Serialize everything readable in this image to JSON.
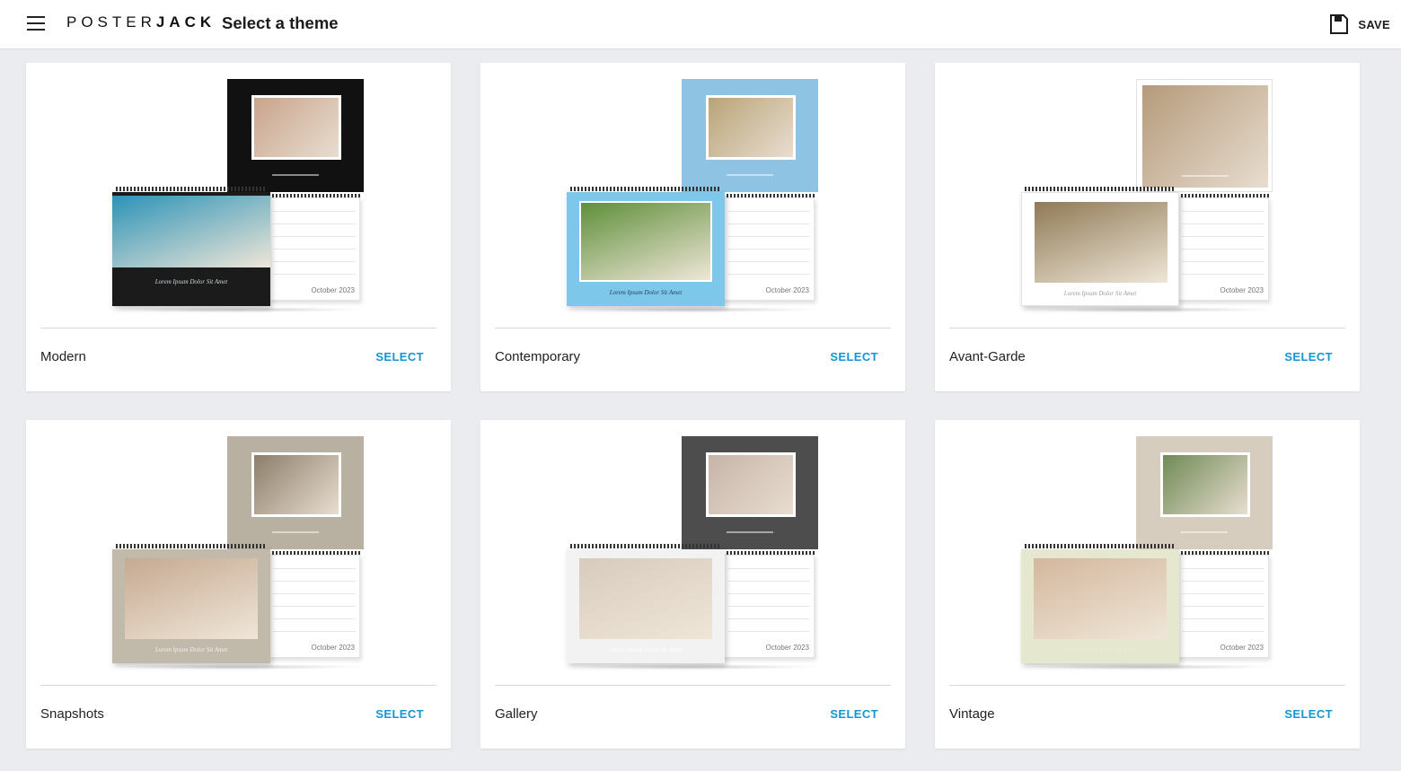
{
  "header": {
    "logo_regular": "POSTER",
    "logo_bold": "JACK",
    "title": "Select a theme",
    "save_label": "SAVE"
  },
  "calendar_month": "October 2023",
  "themes": [
    {
      "name": "Modern",
      "select_label": "SELECT",
      "back_color": "#111111",
      "front_color": "#1b1b1b",
      "photo_back": "#c9a48c",
      "photo_front": "#2c93b7",
      "caption": "Lorem Ipsum Dolor Sit Amet",
      "caption_color": "#cfd6db"
    },
    {
      "name": "Contemporary",
      "select_label": "SELECT",
      "back_color": "#8ec3e3",
      "front_color": "#7dc7ea",
      "photo_back": "#b9a478",
      "photo_front": "#5f8f3a",
      "caption": "Lorem Ipsum Dolor Sit Amet",
      "caption_color": "#24425a"
    },
    {
      "name": "Avant-Garde",
      "select_label": "SELECT",
      "back_color": "#ffffff",
      "front_color": "#ffffff",
      "photo_back": "#b59a7a",
      "photo_front": "#8f7a55",
      "caption": "Lorem Ipsum Dolor Sit Amet",
      "caption_color": "#9a9a9a"
    },
    {
      "name": "Snapshots",
      "select_label": "SELECT",
      "back_color": "#b8b1a2",
      "front_color": "#c1baab",
      "photo_back": "#8c7e6a",
      "photo_front": "#c6a991",
      "caption": "Lorem Ipsum Dolor Sit Amet",
      "caption_color": "#f0f0f0"
    },
    {
      "name": "Gallery",
      "select_label": "SELECT",
      "back_color": "#4d4d4d",
      "front_color": "#f2f2f2",
      "photo_back": "#c7b4a8",
      "photo_front": "#d8cbbd",
      "caption": "Lorem Ipsum Dolor Sit Amet",
      "caption_color": "#ffffff"
    },
    {
      "name": "Vintage",
      "select_label": "SELECT",
      "back_color": "#d6cdbf",
      "front_color": "#e6e7cf",
      "photo_back": "#6f8a55",
      "photo_front": "#d4b79d",
      "caption": "Lorem Ipsum Dolor Sit Amet",
      "caption_color": "#f1ecd6"
    }
  ]
}
